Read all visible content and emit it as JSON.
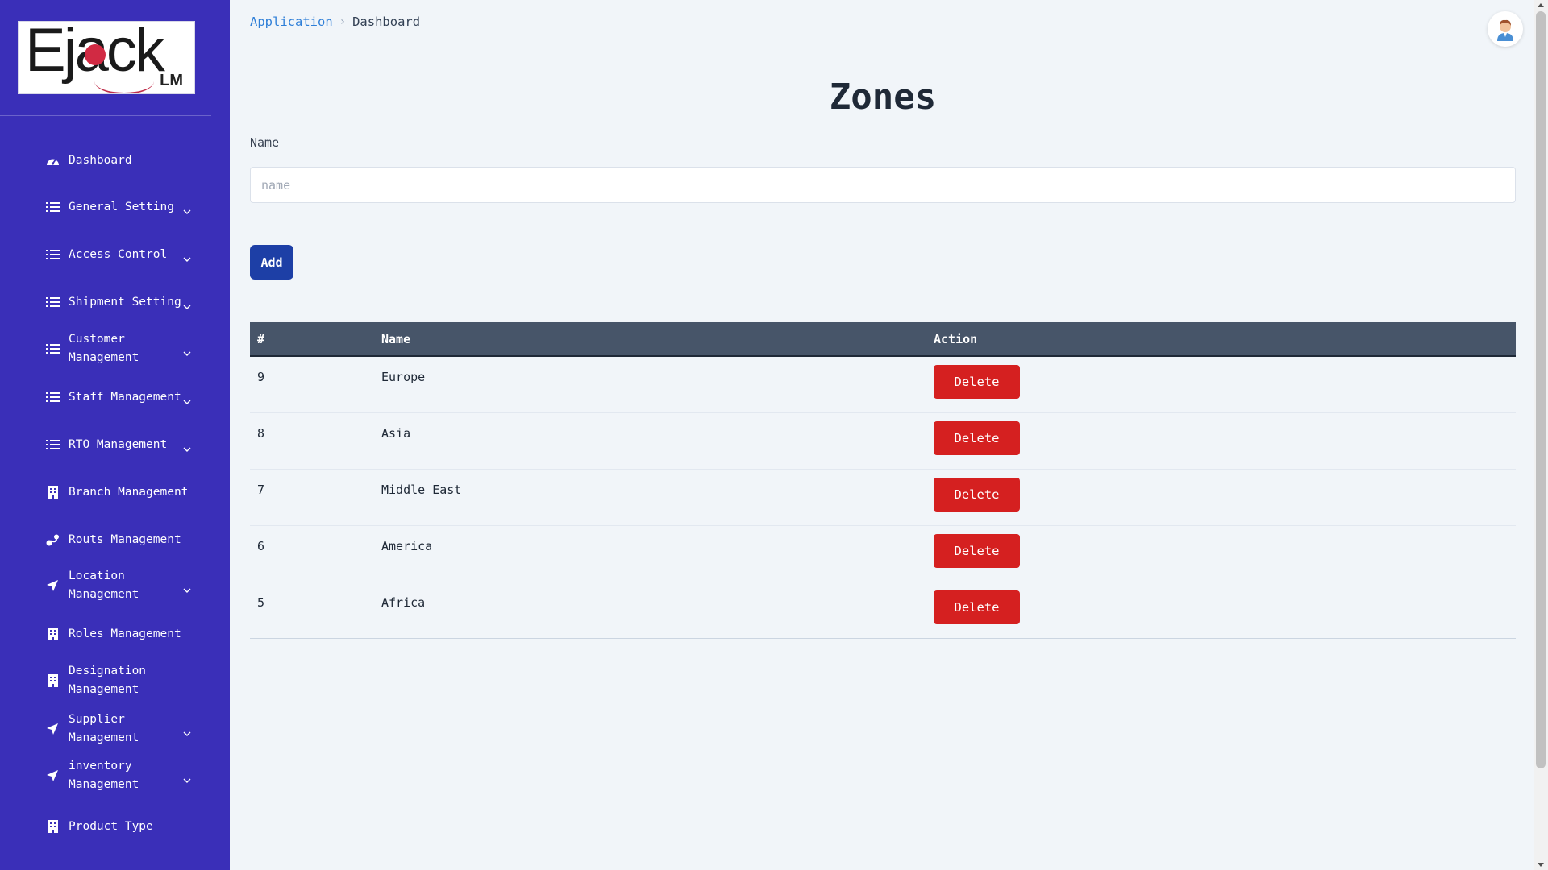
{
  "brand": {
    "logo_text": "Ejack",
    "logo_suffix": "LM"
  },
  "sidebar": {
    "items": [
      {
        "label": "Dashboard",
        "icon": "dashboard-icon",
        "chevron": false
      },
      {
        "label": "General Setting",
        "icon": "list-icon",
        "chevron": true
      },
      {
        "label": "Access Control",
        "icon": "list-icon",
        "chevron": true
      },
      {
        "label": "Shipment Setting",
        "icon": "list-icon",
        "chevron": true
      },
      {
        "label": "Customer\nManagement",
        "icon": "list-icon",
        "chevron": true
      },
      {
        "label": "Staff Management",
        "icon": "list-icon",
        "chevron": true
      },
      {
        "label": "RTO Management",
        "icon": "list-icon",
        "chevron": true
      },
      {
        "label": "Branch Management",
        "icon": "building-icon",
        "chevron": false
      },
      {
        "label": "Routs Management",
        "icon": "route-icon",
        "chevron": false
      },
      {
        "label": "Location\nManagement",
        "icon": "location-arrow-icon",
        "chevron": true
      },
      {
        "label": "Roles Management",
        "icon": "building-icon",
        "chevron": false
      },
      {
        "label": "Designation\nManagement",
        "icon": "building-icon",
        "chevron": false
      },
      {
        "label": "Supplier\nManagement",
        "icon": "location-arrow-icon",
        "chevron": true
      },
      {
        "label": "inventory\nManagement",
        "icon": "location-arrow-icon",
        "chevron": true
      },
      {
        "label": "Product Type",
        "icon": "building-icon",
        "chevron": false
      }
    ]
  },
  "breadcrumb": {
    "parent": "Application",
    "separator": "›",
    "current": "Dashboard"
  },
  "page": {
    "title": "Zones"
  },
  "form": {
    "name_label": "Name",
    "name_placeholder": "name",
    "name_value": "",
    "add_label": "Add"
  },
  "table": {
    "headers": [
      "#",
      "Name",
      "Action"
    ],
    "rows": [
      {
        "id": "9",
        "name": "Europe",
        "action": "Delete"
      },
      {
        "id": "8",
        "name": "Asia",
        "action": "Delete"
      },
      {
        "id": "7",
        "name": "Middle East",
        "action": "Delete"
      },
      {
        "id": "6",
        "name": "America",
        "action": "Delete"
      },
      {
        "id": "5",
        "name": "Africa",
        "action": "Delete"
      }
    ]
  },
  "colors": {
    "sidebar": "#3a2fb8",
    "primary_button": "#1d3fa6",
    "danger_button": "#d52020",
    "table_header": "#475569",
    "link": "#2f7fd8"
  }
}
